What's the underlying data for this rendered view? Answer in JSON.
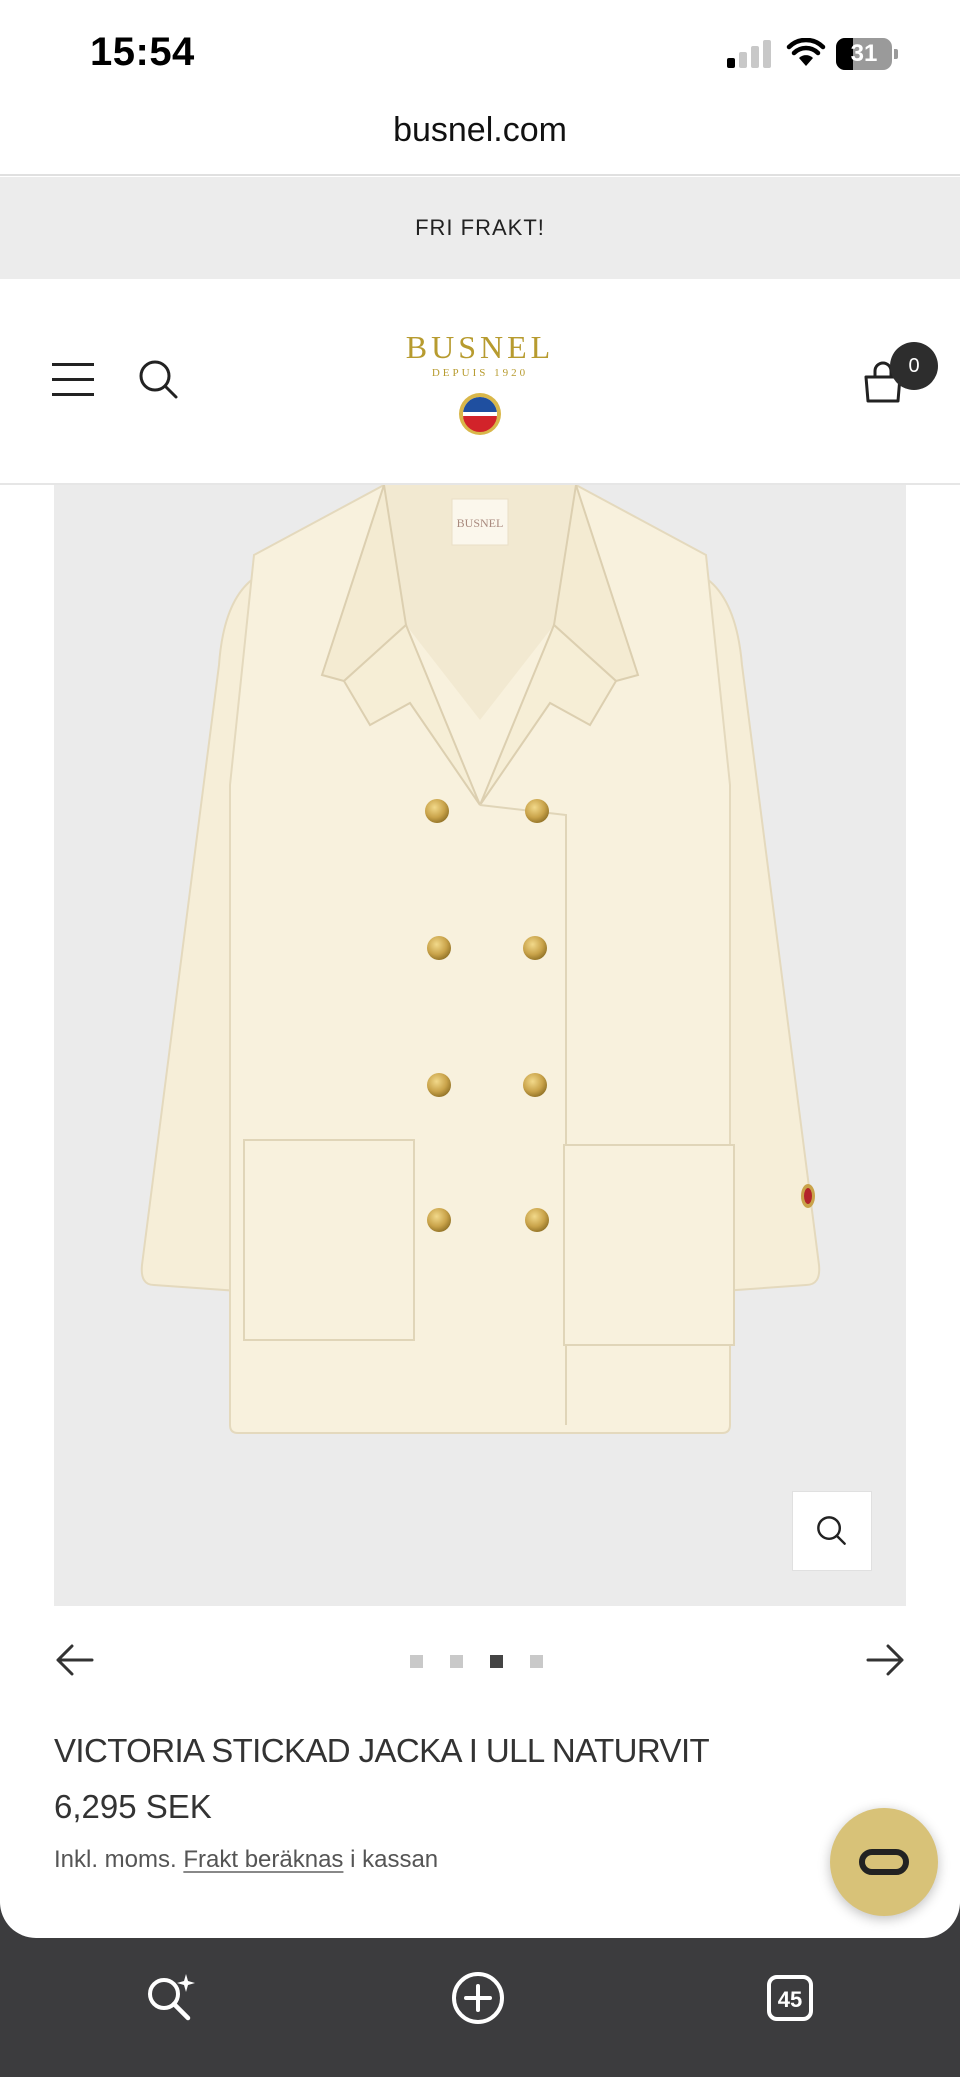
{
  "status_bar": {
    "time": "15:54",
    "battery": "31",
    "battery_level": 0.31
  },
  "browser": {
    "url": "busnel.com",
    "tab_count": "45"
  },
  "promo_banner": {
    "text": "FRI FRAKT!"
  },
  "header": {
    "logo_text": "BUSNEL",
    "logo_subtext": "DEPUIS 1920",
    "cart_count": "0"
  },
  "gallery": {
    "garment_label": "BUSNEL",
    "total_slides": 4,
    "active_slide": 3
  },
  "product": {
    "title": "VICTORIA STICKAD JACKA I ULL NATURVIT",
    "price": "6,295 SEK",
    "tax_prefix": "Inkl. moms.",
    "shipping_link": "Frakt beräknas",
    "tax_suffix": "i kassan"
  },
  "chat": {
    "icon": "chat-logo-icon"
  },
  "colors": {
    "brand_gold": "#b79b2f",
    "chat_button": "#d8c278",
    "promo_bg": "#ececec",
    "gallery_bg": "#ebebeb",
    "garment": "#f7f0db",
    "button_gold": "#c9a34a"
  }
}
